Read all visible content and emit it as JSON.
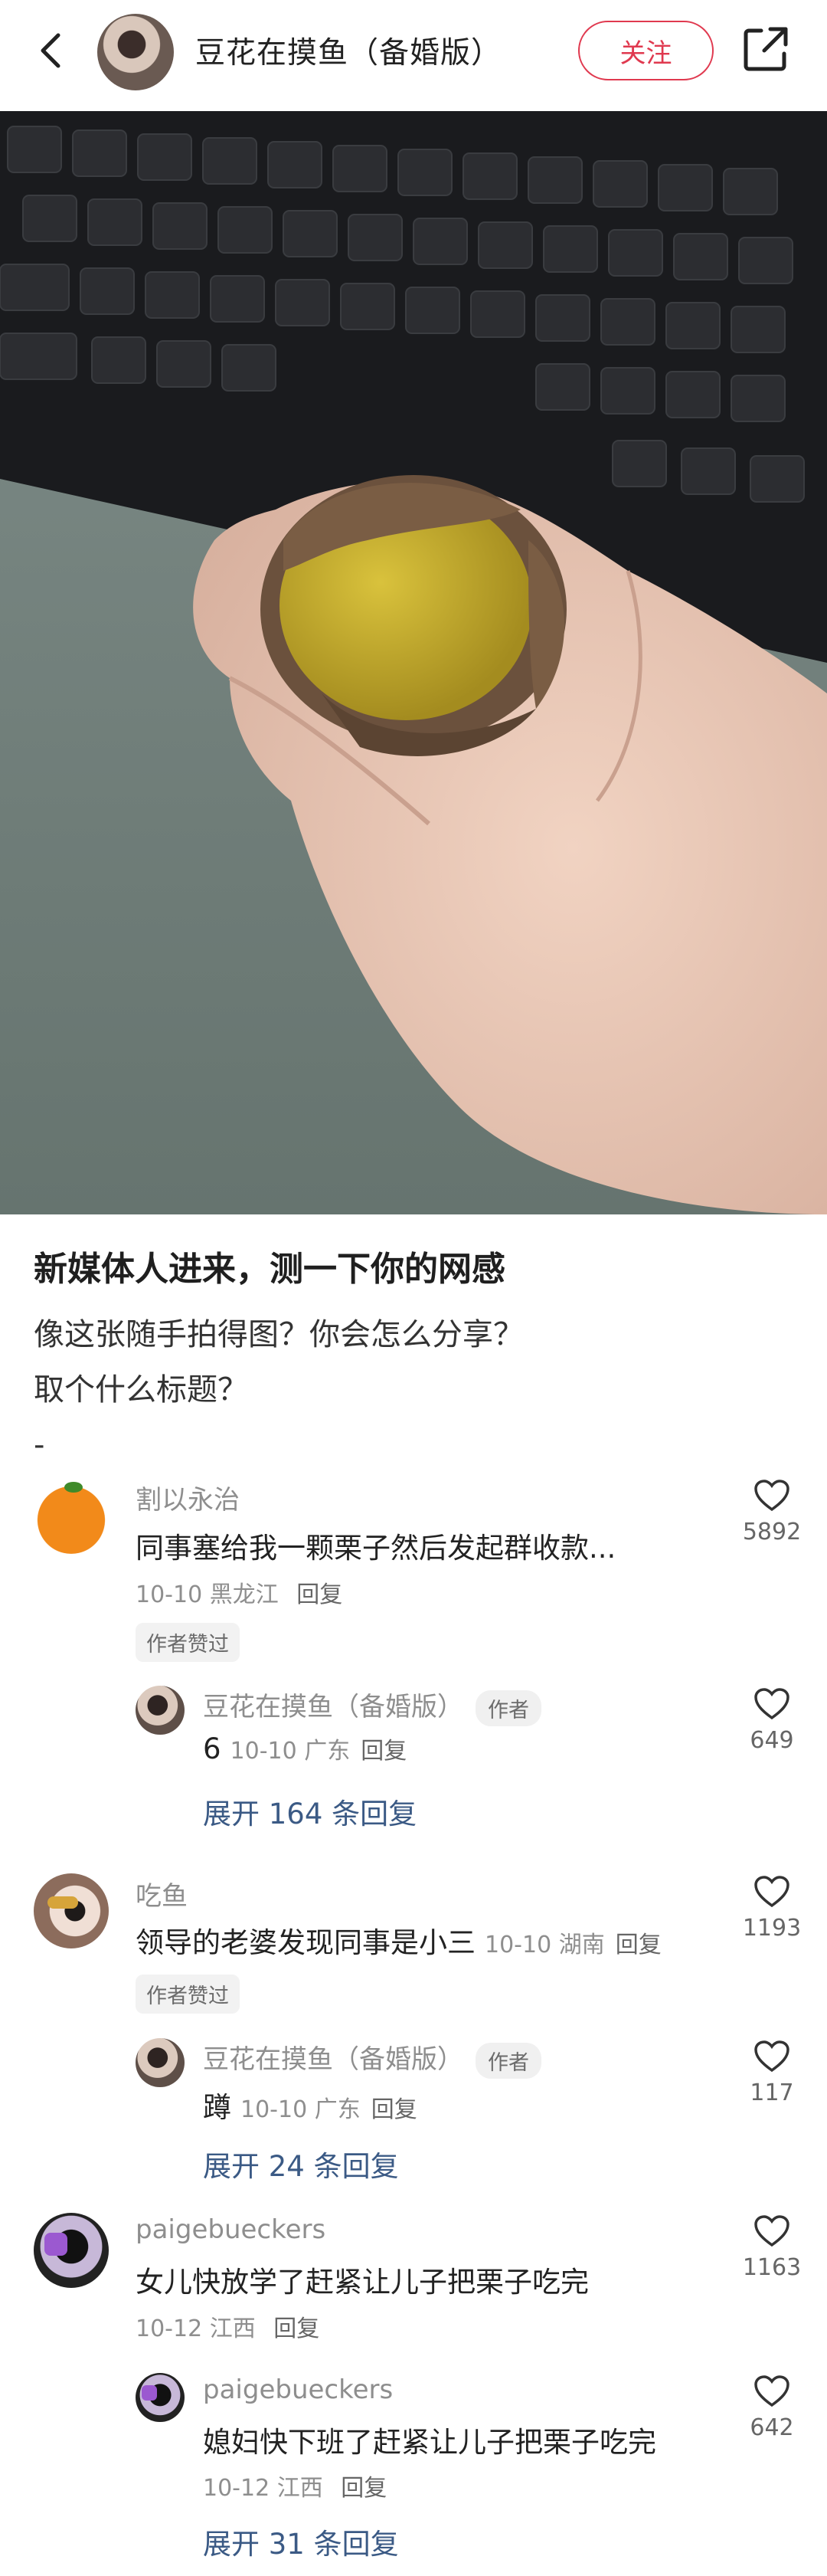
{
  "header": {
    "author_name": "豆花在摸鱼（备婚版）",
    "follow_label": "关注"
  },
  "post": {
    "title": "新媒体人进来，测一下你的网感",
    "body": "像这张随手拍得图？你会怎么分享？\n取个什么标题？\n-"
  },
  "comments": [
    {
      "user": "割以永治",
      "text": "同事塞给我一颗栗子然后发起群收款...",
      "date": "10-10",
      "location": "黑龙江",
      "reply_label": "回复",
      "likes": "5892",
      "badge": "作者赞过",
      "sub_reply": {
        "user": "豆花在摸鱼（备婚版）",
        "author_tag": "作者",
        "text": "6",
        "date": "10-10",
        "location": "广东",
        "reply_label": "回复",
        "likes": "649"
      },
      "expand_label": "展开 164 条回复"
    },
    {
      "user": "吃鱼",
      "text": "领导的老婆发现同事是小三",
      "date": "10-10",
      "location": "湖南",
      "reply_label": "回复",
      "likes": "1193",
      "badge": "作者赞过",
      "sub_reply": {
        "user": "豆花在摸鱼（备婚版）",
        "author_tag": "作者",
        "text": "蹲",
        "date": "10-10",
        "location": "广东",
        "reply_label": "回复",
        "likes": "117"
      },
      "expand_label": "展开 24 条回复"
    },
    {
      "user": "paigebueckers",
      "text": "女儿快放学了赶紧让儿子把栗子吃完",
      "date": "10-12",
      "location": "江西",
      "reply_label": "回复",
      "likes": "1163",
      "sub_reply": {
        "user": "paigebueckers",
        "text": "媳妇快下班了赶紧让儿子把栗子吃完",
        "date": "10-12",
        "location": "江西",
        "reply_label": "回复",
        "likes": "642"
      },
      "expand_label": "展开 31 条回复"
    }
  ],
  "colors": {
    "accent": "#e0394f",
    "link": "#3b5a85"
  }
}
